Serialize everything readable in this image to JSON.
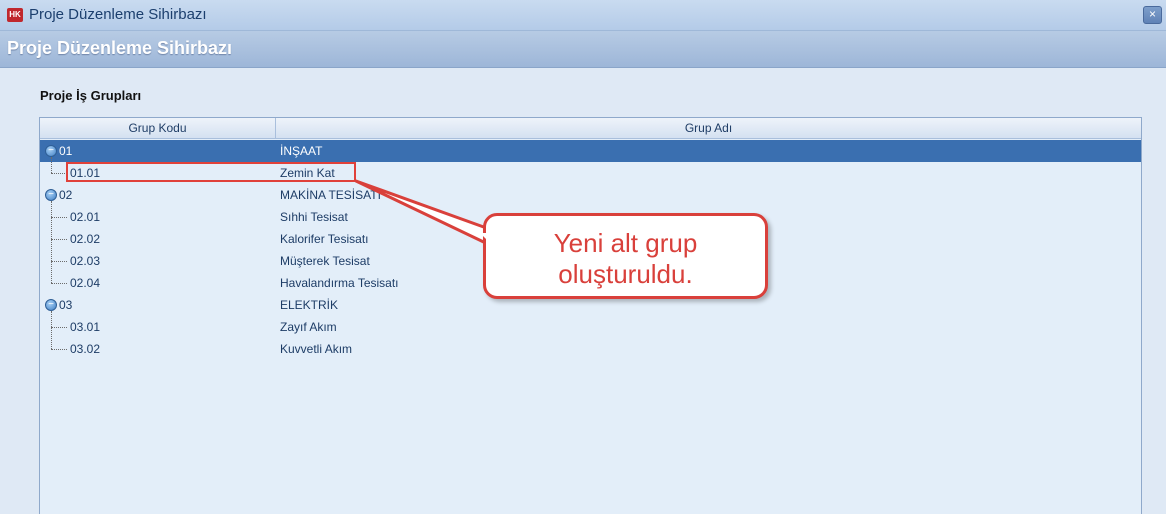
{
  "window": {
    "title": "Proje Düzenleme Sihirbazı",
    "app_icon_text": "HK",
    "close_glyph": "×"
  },
  "header": {
    "title": "Proje Düzenleme Sihirbazı"
  },
  "section": {
    "label": "Proje İş Grupları"
  },
  "grid": {
    "columns": [
      "Grup Kodu",
      "Grup Adı"
    ],
    "rows": [
      {
        "code": "01",
        "name": "İNŞAAT",
        "level": 0,
        "selected": true
      },
      {
        "code": "01.01",
        "name": "Zemin Kat",
        "level": 1
      },
      {
        "code": "02",
        "name": "MAKİNA TESİSATI",
        "level": 0
      },
      {
        "code": "02.01",
        "name": "Sıhhi Tesisat",
        "level": 1
      },
      {
        "code": "02.02",
        "name": "Kalorifer Tesisatı",
        "level": 1
      },
      {
        "code": "02.03",
        "name": "Müşterek Tesisat",
        "level": 1
      },
      {
        "code": "02.04",
        "name": "Havalandırma Tesisatı",
        "level": 1
      },
      {
        "code": "03",
        "name": "ELEKTRİK",
        "level": 0
      },
      {
        "code": "03.01",
        "name": "Zayıf Akım",
        "level": 1
      },
      {
        "code": "03.02",
        "name": "Kuvvetli Akım",
        "level": 1
      }
    ]
  },
  "callout": {
    "line1": "Yeni alt grup",
    "line2": "oluşturuldu."
  },
  "colors": {
    "selection": "#3a6fb0",
    "annotation_red": "#d9403b"
  }
}
